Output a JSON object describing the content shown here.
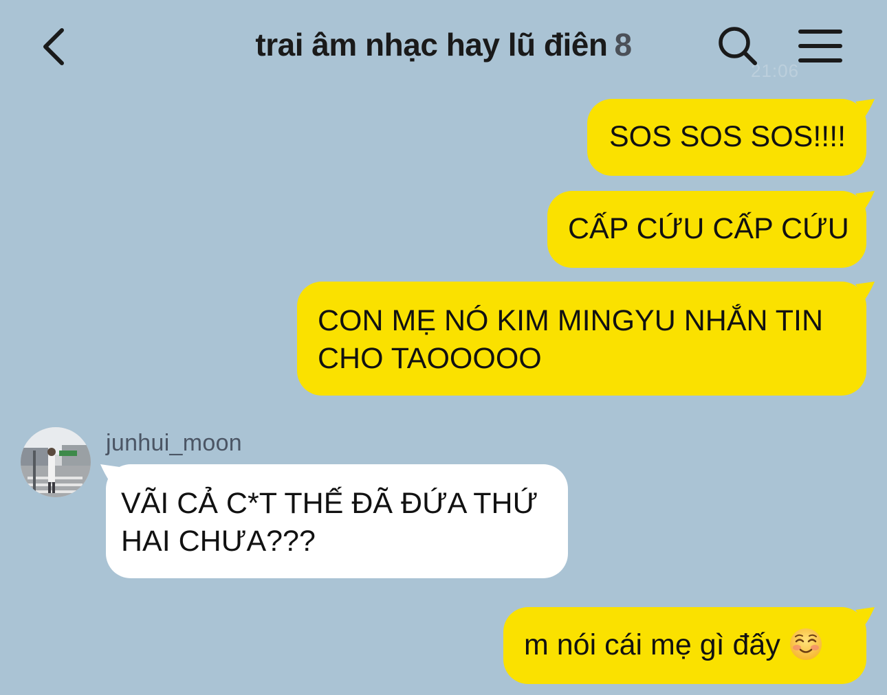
{
  "header": {
    "title": "trai âm nhạc hay lũ điên",
    "member_count": "8",
    "back_icon": "chevron-left-icon",
    "search_icon": "search-icon",
    "menu_icon": "hamburger-menu-icon",
    "ghost_time": "21:06"
  },
  "colors": {
    "background": "#aac3d4",
    "my_bubble": "#fae100",
    "other_bubble": "#ffffff",
    "title_text": "#1a1a1a",
    "username_text": "#4b5564"
  },
  "messages": [
    {
      "sender": "me",
      "text": "SOS SOS SOS!!!!"
    },
    {
      "sender": "me",
      "text": "CẤP CỨU CẤP CỨU"
    },
    {
      "sender": "me",
      "text": "CON MẸ NÓ KIM MINGYU NHẮN TIN CHO TAOOOOO"
    },
    {
      "sender": "junhui_moon",
      "text": "VÃI CẢ C*T THẾ ĐÃ ĐỨA THỨ HAI CHƯA???"
    },
    {
      "sender": "me",
      "text": "m nói cái mẹ gì đấy",
      "emoji": "smiling-blushing-face-icon"
    }
  ],
  "other_user": {
    "username": "junhui_moon",
    "avatar": "avatar-photo"
  }
}
